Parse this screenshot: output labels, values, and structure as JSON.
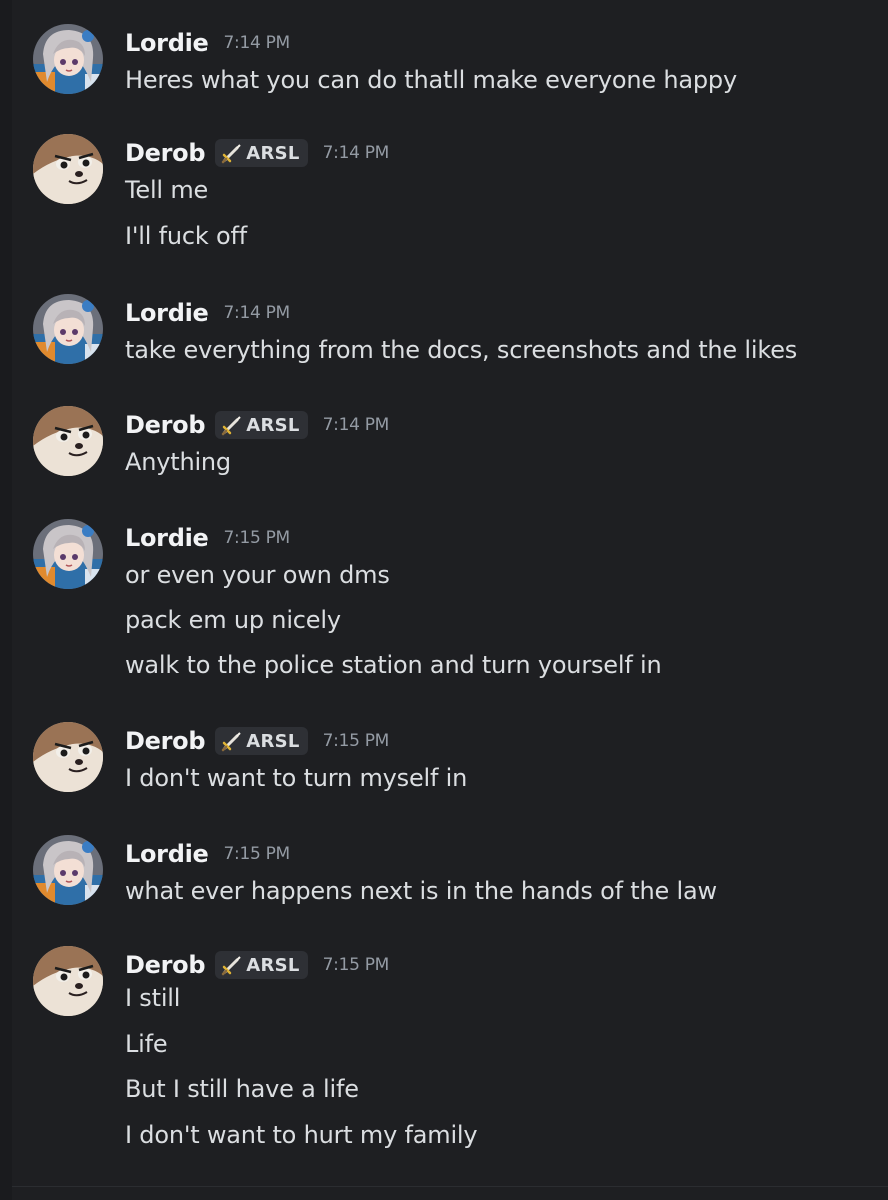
{
  "users": {
    "lordie": {
      "name": "Lordie"
    },
    "derob": {
      "name": "Derob",
      "tag": "ARSL",
      "tag_icon": "sword-icon"
    }
  },
  "colors": {
    "background": "#1e1f22",
    "username": "#f2f3f5",
    "message_text": "#dbdee1",
    "timestamp": "#949ba4",
    "tag_background": "#2e3035"
  },
  "messages": [
    {
      "author": "Lordie",
      "time": "7:14 PM",
      "lines": [
        "Heres what you can do thatll make everyone happy"
      ]
    },
    {
      "author": "Derob",
      "time": "7:14 PM",
      "lines": [
        "Tell me",
        "I'll fuck off"
      ]
    },
    {
      "author": "Lordie",
      "time": "7:14 PM",
      "lines": [
        "take everything from the docs, screenshots and the likes"
      ]
    },
    {
      "author": "Derob",
      "time": "7:14 PM",
      "lines": [
        "Anything"
      ]
    },
    {
      "author": "Lordie",
      "time": "7:15 PM",
      "lines": [
        "or even your own dms",
        "pack em up nicely",
        "walk to the police station and turn yourself in"
      ]
    },
    {
      "author": "Derob",
      "time": "7:15 PM",
      "lines": [
        "I don't want to turn myself in"
      ]
    },
    {
      "author": "Lordie",
      "time": "7:15 PM",
      "lines": [
        "what ever happens next is in the hands of the law"
      ]
    },
    {
      "author": "Derob",
      "time": "7:15 PM",
      "lines": [
        "I still",
        "Life",
        "But I still have a life",
        "I don't want to hurt my family"
      ]
    }
  ]
}
